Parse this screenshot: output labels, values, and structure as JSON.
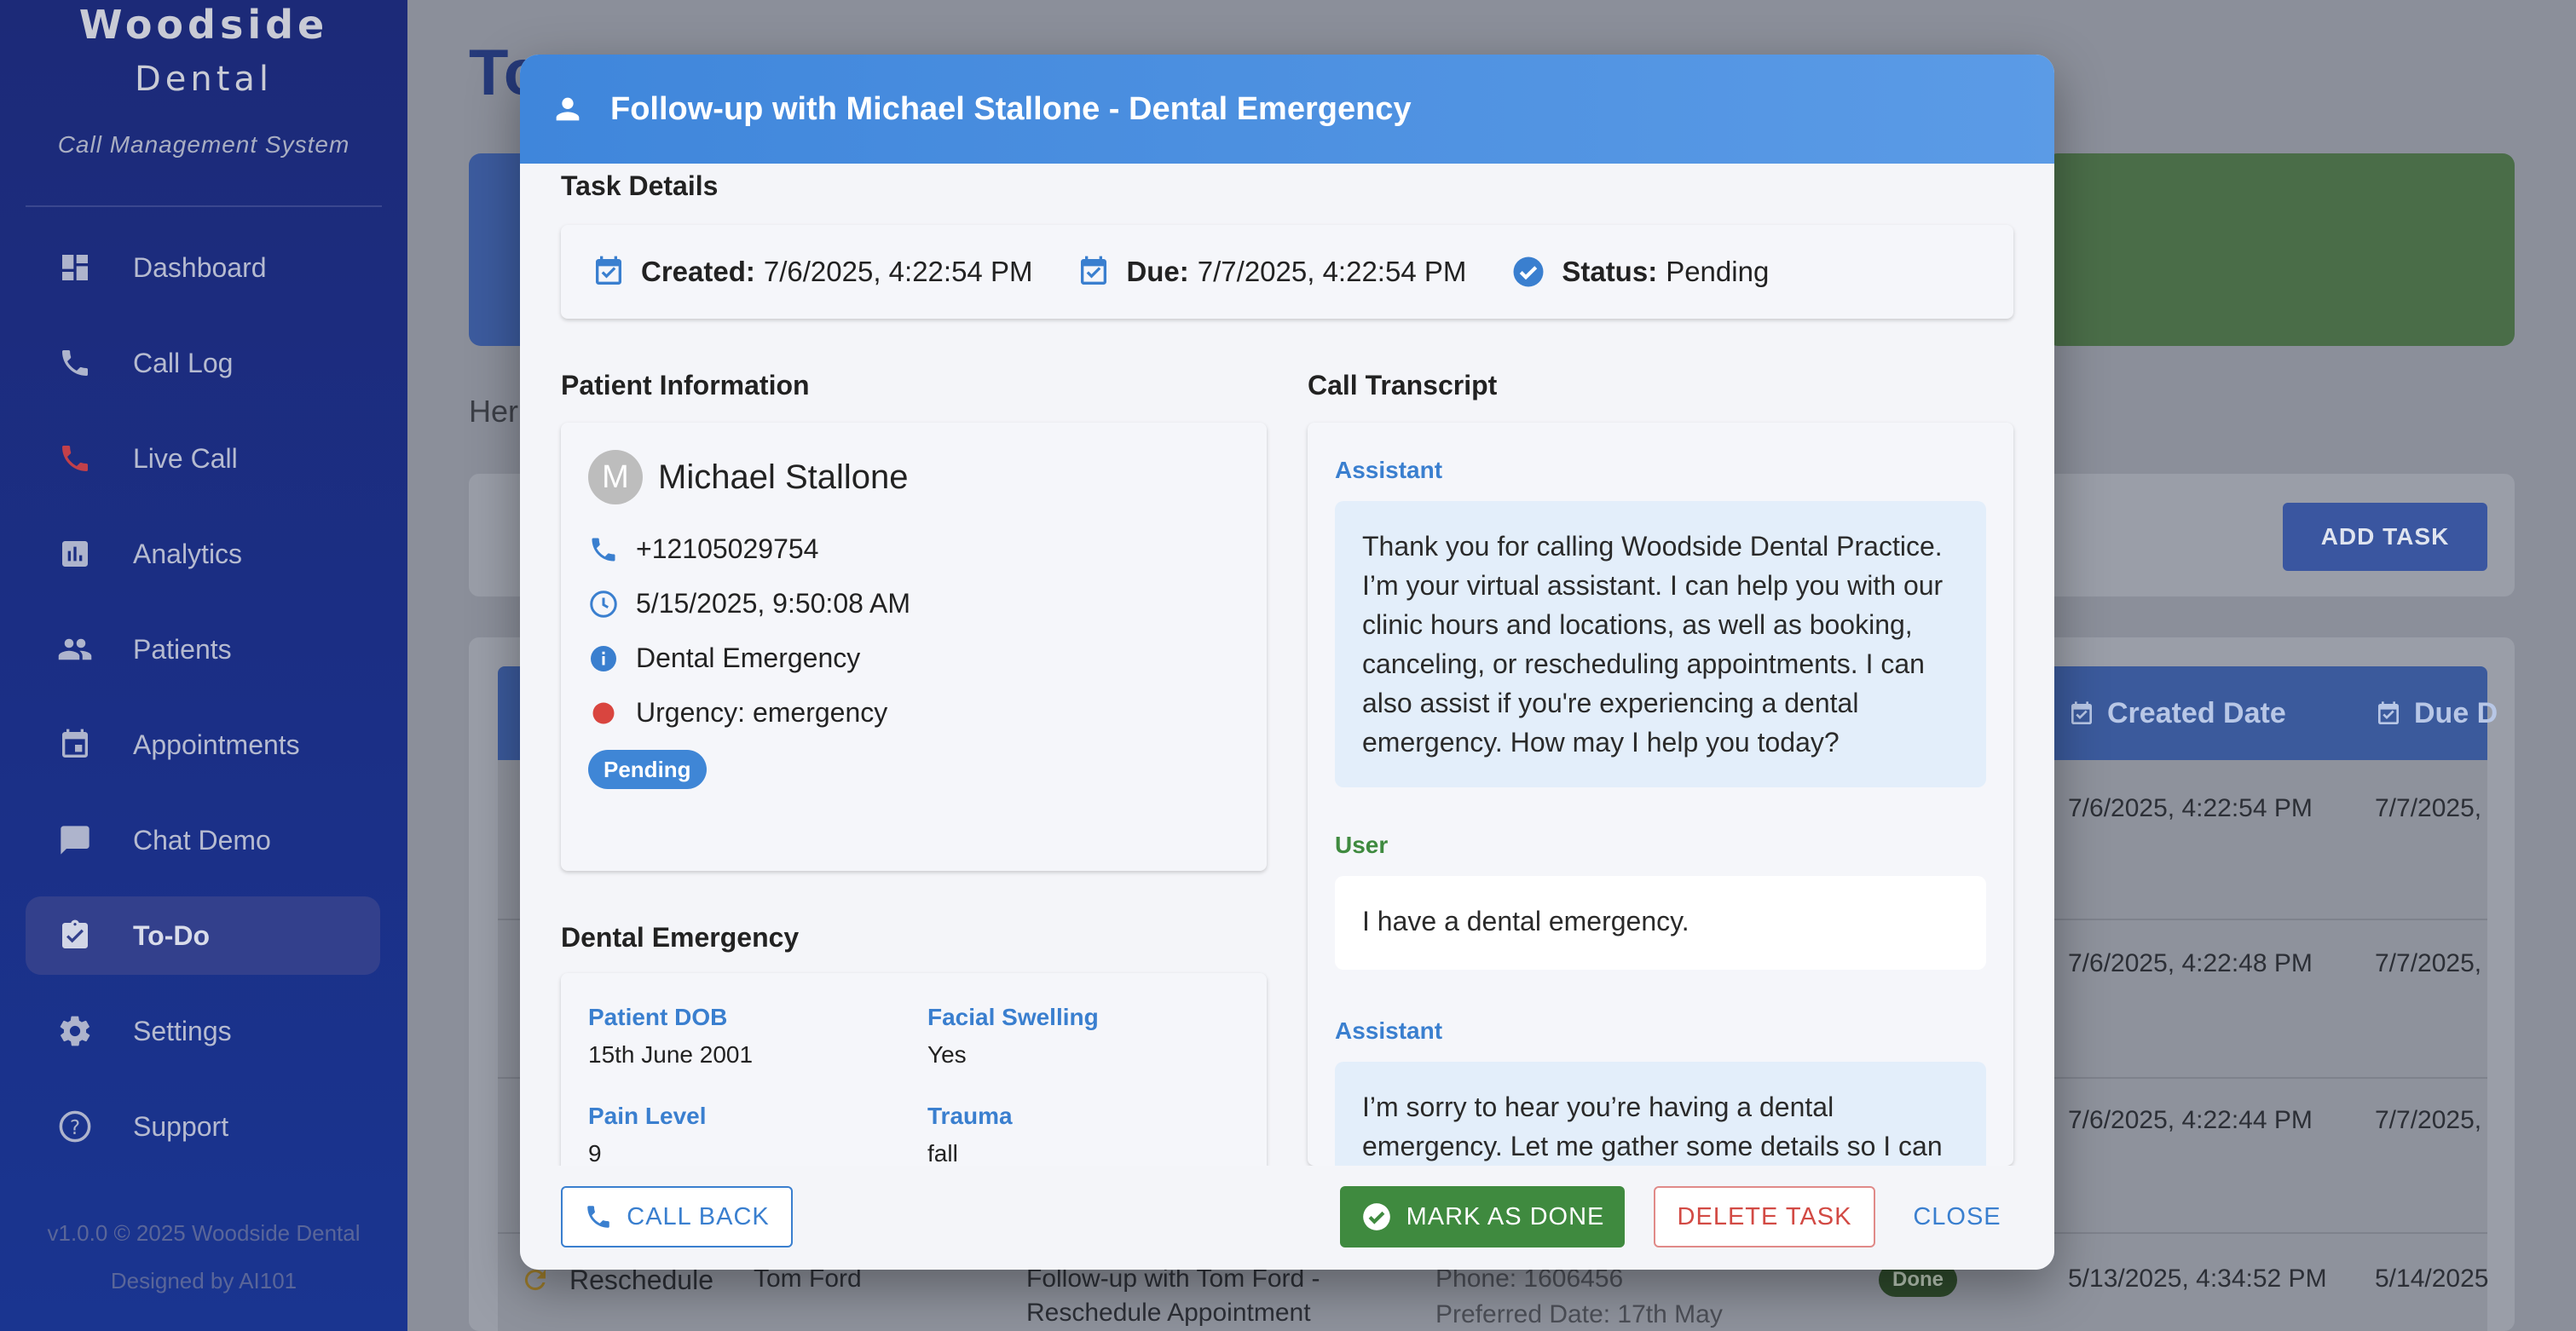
{
  "sidebar": {
    "brand_title": "Woodside",
    "brand_subtitle": "Dental",
    "tagline": "Call Management System",
    "items": [
      {
        "label": "Dashboard",
        "icon": "dashboard-icon"
      },
      {
        "label": "Call Log",
        "icon": "phone-icon"
      },
      {
        "label": "Live Call",
        "icon": "phone-red-icon"
      },
      {
        "label": "Analytics",
        "icon": "bar-chart-icon"
      },
      {
        "label": "Patients",
        "icon": "people-icon"
      },
      {
        "label": "Appointments",
        "icon": "calendar-icon"
      },
      {
        "label": "Chat Demo",
        "icon": "chat-icon"
      },
      {
        "label": "To-Do",
        "icon": "clipboard-check-icon",
        "active": true
      },
      {
        "label": "Settings",
        "icon": "gear-icon"
      },
      {
        "label": "Support",
        "icon": "help-icon"
      }
    ],
    "footer_version": "v1.0.0 © 2025 Woodside Dental",
    "footer_designed": "Designed by AI101"
  },
  "background": {
    "page_title": "To",
    "here_text": "Her",
    "add_task_label": "ADD TASK",
    "table_headers": [
      "Created Date",
      "Due D"
    ],
    "rows": [
      {
        "created": "7/6/2025, 4:22:54 PM",
        "due": "7/7/2025,"
      },
      {
        "created": "7/6/2025, 4:22:48 PM",
        "due": "7/7/2025,"
      },
      {
        "created": "7/6/2025, 4:22:44 PM",
        "due": "7/7/2025,"
      },
      {
        "type": "Reschedule",
        "patient": "Tom Ford",
        "task_line1": "Follow-up with Tom Ford -",
        "task_line2": "Reschedule Appointment",
        "detail_line1": "Phone: 1606456",
        "detail_line2": "Preferred Date: 17th May",
        "status": "Done",
        "created": "5/13/2025, 4:34:52 PM",
        "due": "5/14/2025"
      }
    ]
  },
  "modal": {
    "title": "Follow-up with Michael Stallone - Dental Emergency",
    "task_details_title": "Task Details",
    "created_label": "Created:",
    "created_value": "7/6/2025, 4:22:54 PM",
    "due_label": "Due:",
    "due_value": "7/7/2025, 4:22:54 PM",
    "status_label": "Status:",
    "status_value": "Pending",
    "patient_info_title": "Patient Information",
    "patient": {
      "avatar_initial": "M",
      "name": "Michael Stallone",
      "phone": "+12105029754",
      "call_time": "5/15/2025, 9:50:08 AM",
      "reason": "Dental Emergency",
      "urgency": "Urgency: emergency",
      "status_pill": "Pending"
    },
    "emergency_title": "Dental Emergency",
    "emergency": {
      "dob_label": "Patient DOB",
      "dob_value": "15th June 2001",
      "swelling_label": "Facial Swelling",
      "swelling_value": "Yes",
      "pain_label": "Pain Level",
      "pain_value": "9",
      "trauma_label": "Trauma",
      "trauma_value": "fall"
    },
    "transcript_title": "Call Transcript",
    "transcript": [
      {
        "speaker": "Assistant",
        "text": "Thank you for calling Woodside Dental Practice. I’m your virtual assistant. I can help you with our clinic hours and locations, as well as booking, canceling, or rescheduling appointments. I can also assist if you're experiencing a dental emergency. How may I help you today?"
      },
      {
        "speaker": "User",
        "text": "I have a dental emergency."
      },
      {
        "speaker": "Assistant",
        "text": "I’m sorry to hear you’re having a dental emergency. Let me gather some details so I can"
      }
    ],
    "buttons": {
      "call_back": "CALL BACK",
      "mark_done": "MARK AS DONE",
      "delete": "DELETE TASK",
      "close": "CLOSE"
    }
  }
}
